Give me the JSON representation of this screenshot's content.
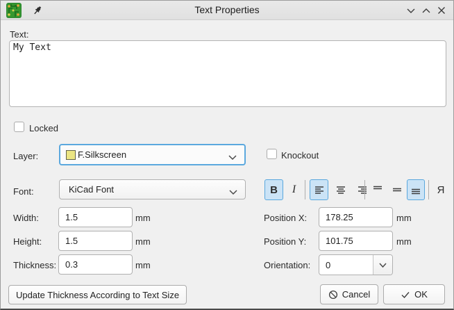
{
  "titlebar": {
    "title": "Text Properties",
    "icons": {
      "app": "kicad-pcbnew-icon",
      "pin": "pin-icon",
      "shade": "chevron-down-icon",
      "rollup": "chevron-up-icon",
      "close": "close-icon"
    }
  },
  "text_section": {
    "label": "Text:",
    "value": "My Text"
  },
  "locked": {
    "label": "Locked",
    "checked": false
  },
  "layer": {
    "label": "Layer:",
    "value": "F.Silkscreen",
    "swatch_color": "#ebe583"
  },
  "knockout": {
    "label": "Knockout",
    "checked": false
  },
  "font": {
    "label": "Font:",
    "value": "KiCad Font"
  },
  "format": {
    "bold_label": "B",
    "bold_active": true,
    "italic_label": "I",
    "italic_active": false,
    "align_left_active": true,
    "align_center_active": false,
    "align_right_active": false,
    "valign_top_active": false,
    "valign_middle_active": false,
    "valign_bottom_active": true,
    "mirror_label": "Я",
    "mirror_active": false
  },
  "fields": {
    "width": {
      "label": "Width:",
      "value": "1.5",
      "unit": "mm"
    },
    "height": {
      "label": "Height:",
      "value": "1.5",
      "unit": "mm"
    },
    "thickness": {
      "label": "Thickness:",
      "value": "0.3",
      "unit": "mm"
    },
    "position_x": {
      "label": "Position X:",
      "value": "178.25",
      "unit": "mm"
    },
    "position_y": {
      "label": "Position Y:",
      "value": "101.75",
      "unit": "mm"
    },
    "orientation": {
      "label": "Orientation:",
      "value": "0"
    }
  },
  "buttons": {
    "update_thickness": "Update Thickness According to Text Size",
    "cancel": "Cancel",
    "ok": "OK"
  },
  "colors": {
    "accent": "#59a7dd",
    "active_bg": "#cbe3f6",
    "silkscreen_yellow": "#ebe583"
  }
}
